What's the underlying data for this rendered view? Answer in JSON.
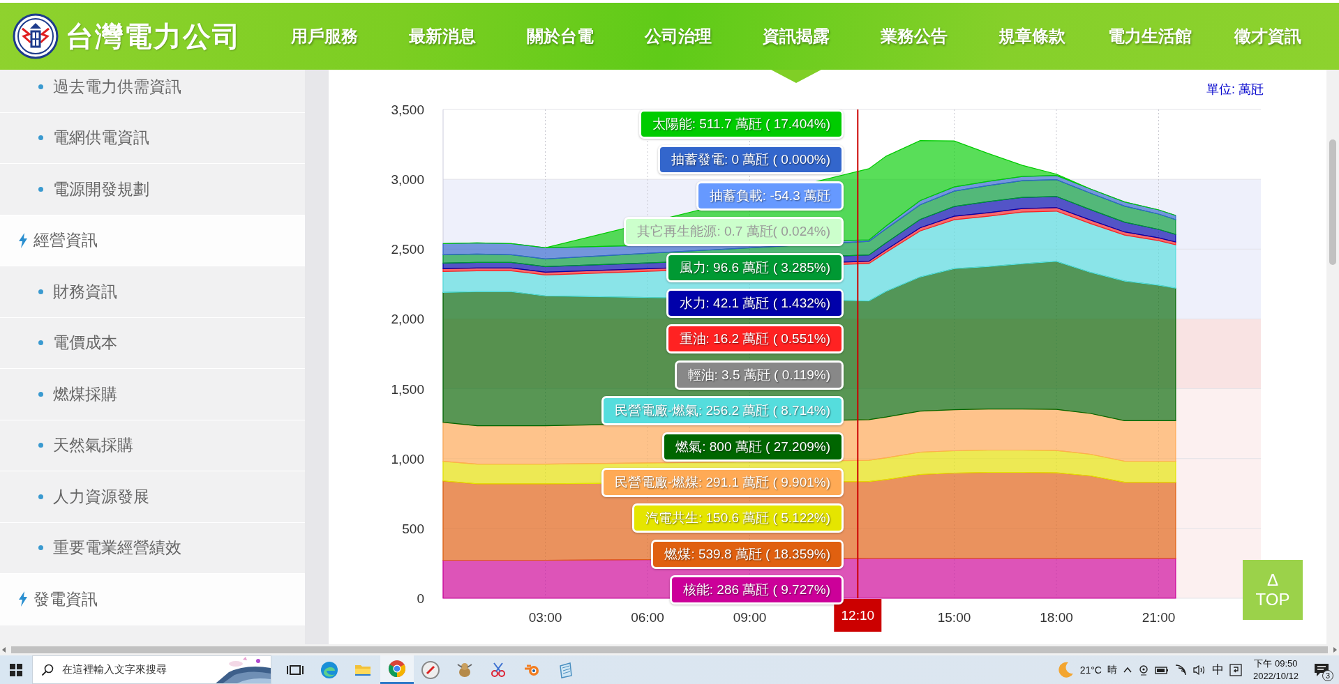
{
  "header": {
    "logo_text": "台灣電力公司",
    "nav": [
      {
        "label": "用戶服務",
        "selected": false
      },
      {
        "label": "最新消息",
        "selected": false
      },
      {
        "label": "關於台電",
        "selected": false
      },
      {
        "label": "公司治理",
        "selected": false
      },
      {
        "label": "資訊揭露",
        "selected": true
      },
      {
        "label": "業務公告",
        "selected": false
      },
      {
        "label": "規章條款",
        "selected": false
      },
      {
        "label": "電力生活館",
        "selected": false
      },
      {
        "label": "徵才資訊",
        "selected": false
      }
    ]
  },
  "sidebar": {
    "items": [
      {
        "kind": "sub",
        "label": "過去電力供需資訊"
      },
      {
        "kind": "sub",
        "label": "電網供電資訊"
      },
      {
        "kind": "sub",
        "label": "電源開發規劃"
      },
      {
        "kind": "section",
        "label": "經營資訊"
      },
      {
        "kind": "sub",
        "label": "財務資訊"
      },
      {
        "kind": "sub",
        "label": "電價成本"
      },
      {
        "kind": "sub",
        "label": "燃煤採購"
      },
      {
        "kind": "sub",
        "label": "天然氣採購"
      },
      {
        "kind": "sub",
        "label": "人力資源發展"
      },
      {
        "kind": "sub",
        "label": "重要電業經營績效"
      },
      {
        "kind": "section",
        "label": "發電資訊"
      }
    ]
  },
  "chart": {
    "unit": "單位: 萬瓩",
    "chart_data": {
      "type": "area",
      "stacked": true,
      "grid": true,
      "x": [
        0,
        1,
        2,
        3,
        12.5,
        13,
        14,
        15,
        16,
        17,
        18,
        19,
        20,
        21,
        21.5
      ],
      "xlim": [
        0,
        24
      ],
      "ylim": [
        0,
        3500
      ],
      "xticks": [
        {
          "value": 3,
          "label": "03:00"
        },
        {
          "value": 6,
          "label": "06:00"
        },
        {
          "value": 9,
          "label": "09:00"
        },
        {
          "value": 15,
          "label": "15:00"
        },
        {
          "value": 18,
          "label": "18:00"
        },
        {
          "value": 21,
          "label": "21:00"
        }
      ],
      "yticks": [
        {
          "value": 0,
          "label": "0"
        },
        {
          "value": 500,
          "label": "500"
        },
        {
          "value": 1000,
          "label": "1,000"
        },
        {
          "value": 1500,
          "label": "1,500"
        },
        {
          "value": 2000,
          "label": "2,000"
        },
        {
          "value": 2500,
          "label": "2,500"
        },
        {
          "value": 3000,
          "label": "3,000"
        },
        {
          "value": 3500,
          "label": "3,500"
        }
      ],
      "bands": [
        {
          "axis": "y",
          "from": 2000,
          "to": 3000,
          "color": "#eef0fb"
        },
        {
          "axis": "y",
          "from": 1500,
          "to": 2000,
          "color": "#f9e3e3"
        },
        {
          "axis": "y",
          "from": 0,
          "to": 1500,
          "color": "#fcf0f0"
        }
      ],
      "ref_lines": [
        {
          "axis": "x",
          "value": 12.17,
          "label": "12:10",
          "color": "#cc0000"
        }
      ],
      "series": [
        {
          "color": "#cc0099",
          "values": [
            272,
            272,
            272,
            272,
            286,
            286,
            286,
            286,
            286,
            286,
            286,
            286,
            286,
            286,
            286
          ]
        },
        {
          "color": "#e06010",
          "values": [
            568,
            548,
            548,
            548,
            550,
            564,
            600,
            610,
            615,
            615,
            612,
            590,
            545,
            545,
            545
          ]
        },
        {
          "color": "#e5e500",
          "values": [
            140,
            140,
            140,
            140,
            152,
            155,
            160,
            160,
            160,
            160,
            160,
            155,
            150,
            150,
            150
          ]
        },
        {
          "color": "#ffaa55",
          "values": [
            280,
            275,
            275,
            275,
            291,
            292,
            294,
            294,
            294,
            294,
            294,
            292,
            290,
            290,
            290
          ]
        },
        {
          "color": "#006600",
          "values": [
            930,
            960,
            960,
            930,
            850,
            900,
            960,
            1010,
            1020,
            1040,
            1060,
            1010,
            1000,
            970,
            950
          ]
        },
        {
          "color": "#55dddd",
          "values": [
            150,
            150,
            150,
            150,
            268,
            280,
            330,
            350,
            360,
            370,
            360,
            350,
            330,
            320,
            310
          ]
        },
        {
          "color": "#ff2222",
          "values": [
            20,
            20,
            20,
            20,
            16,
            18,
            22,
            25,
            25,
            25,
            25,
            25,
            22,
            20,
            20
          ]
        },
        {
          "color": "#0000aa",
          "values": [
            40,
            40,
            40,
            40,
            45,
            50,
            60,
            70,
            80,
            80,
            80,
            75,
            70,
            60,
            55
          ]
        },
        {
          "color": "#009933",
          "values": [
            60,
            60,
            55,
            55,
            98,
            100,
            105,
            110,
            115,
            120,
            120,
            118,
            115,
            110,
            105
          ]
        },
        {
          "color": "#3366cc",
          "values": [
            80,
            80,
            80,
            80,
            10,
            20,
            30,
            30,
            30,
            30,
            30,
            30,
            30,
            30,
            30
          ]
        },
        {
          "color": "#00cc00",
          "values": [
            0,
            0,
            0,
            0,
            510,
            500,
            430,
            330,
            200,
            80,
            10,
            0,
            0,
            0,
            0
          ]
        }
      ]
    },
    "tooltip": [
      {
        "name": "太陽能",
        "reading": ": 511.7 萬瓩 ( 17.404%)",
        "color": "#00cc00"
      },
      {
        "name": "抽蓄發電",
        "reading": ": 0 萬瓩 ( 0.000%)",
        "color": "#3366cc"
      },
      {
        "name": "抽蓄負載",
        "reading": ": -54.3 萬瓩",
        "color": "#6699ff"
      },
      {
        "name": "其它再生能源",
        "reading": ": 0.7 萬瓩( 0.024%)",
        "color": "#ccffcc"
      },
      {
        "name": "風力",
        "reading": ": 96.6 萬瓩 ( 3.285%)",
        "color": "#009933"
      },
      {
        "name": "水力",
        "reading": ": 42.1 萬瓩 ( 1.432%)",
        "color": "#0000aa"
      },
      {
        "name": "重油",
        "reading": ": 16.2 萬瓩 ( 0.551%)",
        "color": "#ff2222"
      },
      {
        "name": "輕油",
        "reading": ": 3.5 萬瓩 ( 0.119%)",
        "color": "#888888"
      },
      {
        "name": "民營電廠-燃氣",
        "reading": ": 256.2 萬瓩 ( 8.714%)",
        "color": "#55dddd"
      },
      {
        "name": "燃氣",
        "reading": ": 800 萬瓩 ( 27.209%)",
        "color": "#006600"
      },
      {
        "name": "民營電廠-燃煤",
        "reading": ": 291.1 萬瓩 ( 9.901%)",
        "color": "#ffaa55"
      },
      {
        "name": "汽電共生",
        "reading": ": 150.6 萬瓩 ( 5.122%)",
        "color": "#e5e500"
      },
      {
        "name": "燃煤",
        "reading": ": 539.8 萬瓩 ( 18.359%)",
        "color": "#e06010"
      },
      {
        "name": "核能",
        "reading": ": 286 萬瓩 ( 9.727%)",
        "color": "#cc0099"
      }
    ]
  },
  "top_button": {
    "icon": "Δ",
    "label": "TOP"
  },
  "taskbar": {
    "search_placeholder": "在這裡輸入文字來搜尋",
    "apps": [
      {
        "kind": "task-view",
        "selected": false
      },
      {
        "kind": "edge",
        "selected": false
      },
      {
        "kind": "folder",
        "selected": false
      },
      {
        "kind": "chrome",
        "selected": true
      },
      {
        "kind": "compass",
        "selected": false
      },
      {
        "kind": "bird",
        "selected": false
      },
      {
        "kind": "scissors",
        "selected": false
      },
      {
        "kind": "blender",
        "selected": false
      },
      {
        "kind": "notepad",
        "selected": false
      }
    ],
    "weather": {
      "temperature": "21°C",
      "condition": "晴"
    },
    "ime": "中",
    "time": "下午 09:50",
    "date": "2022/10/12",
    "notifications": "3"
  }
}
